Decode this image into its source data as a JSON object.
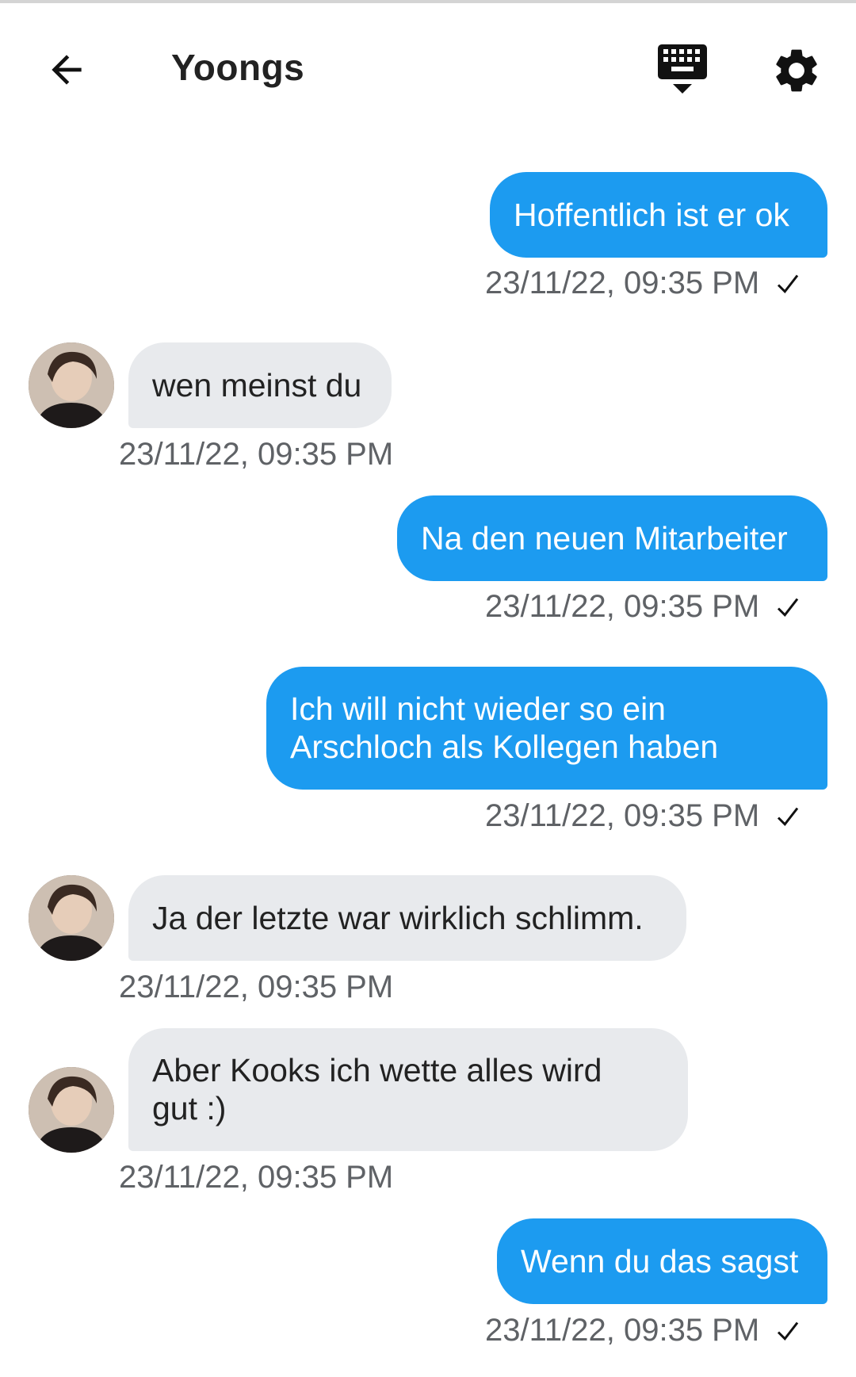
{
  "header": {
    "title": "Yoongs",
    "back_icon": "arrow-left-icon",
    "keyboard_icon": "keyboard-hide-icon",
    "settings_icon": "gear-icon"
  },
  "colors": {
    "outgoing": "#1c9bf0",
    "incoming": "#e8eaed",
    "timestamp": "#5f6266"
  },
  "messages": [
    {
      "direction": "outgoing",
      "lines": [
        "Hoffentlich ist er ok"
      ],
      "timestamp": "23/11/22, 09:35 PM",
      "status": "sent-check-icon"
    },
    {
      "direction": "incoming",
      "lines": [
        "wen meinst du"
      ],
      "timestamp": "23/11/22, 09:35 PM"
    },
    {
      "direction": "outgoing",
      "lines": [
        "Na den neuen Mitarbeiter"
      ],
      "timestamp": "23/11/22, 09:35 PM",
      "status": "sent-check-icon"
    },
    {
      "direction": "outgoing",
      "lines": [
        "Ich will nicht wieder so ein",
        "Arschloch als Kollegen haben"
      ],
      "timestamp": "23/11/22, 09:35 PM",
      "status": "sent-check-icon"
    },
    {
      "direction": "incoming",
      "lines": [
        "Ja der letzte war wirklich schlimm."
      ],
      "timestamp": "23/11/22, 09:35 PM"
    },
    {
      "direction": "incoming",
      "lines": [
        "Aber Kooks ich wette alles wird",
        "gut :)"
      ],
      "timestamp": "23/11/22, 09:35 PM"
    },
    {
      "direction": "outgoing",
      "lines": [
        "Wenn du das sagst"
      ],
      "timestamp": "23/11/22, 09:35 PM",
      "status": "sent-check-icon"
    }
  ]
}
